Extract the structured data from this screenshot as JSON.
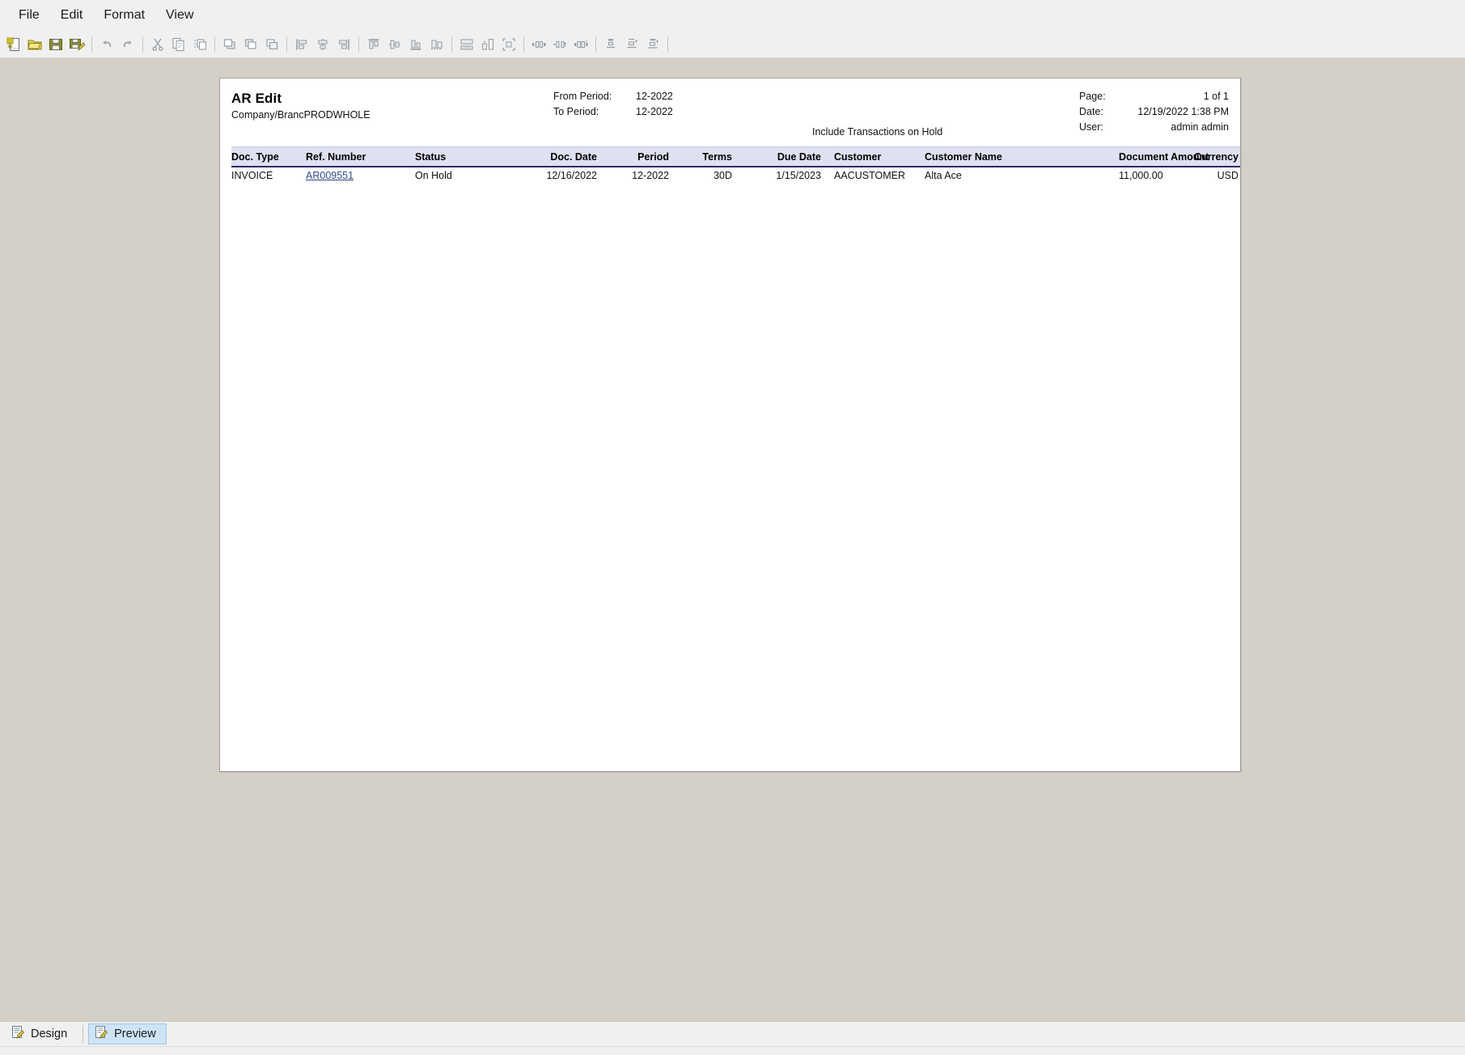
{
  "menubar": {
    "items": [
      {
        "label": "File"
      },
      {
        "label": "Edit"
      },
      {
        "label": "Format"
      },
      {
        "label": "View"
      }
    ]
  },
  "toolbar": {
    "groups": [
      {
        "buttons": [
          {
            "icon": "new-report-icon",
            "name": "new-report-button"
          },
          {
            "icon": "open-folder-icon",
            "name": "open-button"
          },
          {
            "icon": "save-icon",
            "name": "save-button"
          },
          {
            "icon": "save-as-icon",
            "name": "save-as-button"
          }
        ]
      },
      {
        "buttons": [
          {
            "icon": "undo-icon",
            "name": "undo-button"
          },
          {
            "icon": "redo-icon",
            "name": "redo-button"
          }
        ]
      },
      {
        "buttons": [
          {
            "icon": "cut-scissors-icon",
            "name": "cut-button"
          },
          {
            "icon": "copy-icon",
            "name": "copy-button"
          },
          {
            "icon": "paste-icon",
            "name": "paste-button"
          }
        ]
      },
      {
        "buttons": [
          {
            "icon": "bring-to-front-icon",
            "name": "bring-to-front-button"
          },
          {
            "icon": "send-to-back-icon",
            "name": "send-to-back-button"
          },
          {
            "icon": "group-icon",
            "name": "group-button"
          }
        ]
      },
      {
        "buttons": [
          {
            "icon": "align-left-icon",
            "name": "align-left-button"
          },
          {
            "icon": "align-center-icon",
            "name": "align-center-button"
          },
          {
            "icon": "align-right-icon",
            "name": "align-right-button"
          }
        ]
      },
      {
        "buttons": [
          {
            "icon": "align-top-icon",
            "name": "align-top-button"
          },
          {
            "icon": "align-middle-icon",
            "name": "align-middle-button"
          },
          {
            "icon": "align-bottom-icon",
            "name": "align-bottom-button"
          },
          {
            "icon": "align-baseline-icon",
            "name": "align-baseline-button"
          }
        ]
      },
      {
        "buttons": [
          {
            "icon": "same-width-icon",
            "name": "same-width-button"
          },
          {
            "icon": "same-height-icon",
            "name": "same-height-button"
          },
          {
            "icon": "same-size-icon",
            "name": "same-size-button"
          }
        ]
      },
      {
        "buttons": [
          {
            "icon": "space-horizontal-icon",
            "name": "space-horizontal-button"
          },
          {
            "icon": "increase-horizontal-space-icon",
            "name": "increase-horizontal-space-button"
          },
          {
            "icon": "decrease-horizontal-space-icon",
            "name": "decrease-horizontal-space-button"
          }
        ]
      },
      {
        "buttons": [
          {
            "icon": "space-vertical-icon",
            "name": "space-vertical-button"
          },
          {
            "icon": "increase-vertical-space-icon",
            "name": "increase-vertical-space-button"
          },
          {
            "icon": "decrease-vertical-space-icon",
            "name": "decrease-vertical-space-button"
          }
        ]
      }
    ]
  },
  "report": {
    "title": "AR Edit",
    "subtitle": "Company/BrancPRODWHOLE",
    "params": {
      "from_period_label": "From Period:",
      "from_period_value": "12-2022",
      "to_period_label": "To Period:",
      "to_period_value": "12-2022",
      "include_on_hold_note": "Include Transactions on Hold"
    },
    "meta": {
      "page_label": "Page:",
      "page_value": "1 of 1",
      "date_label": "Date:",
      "date_value": "12/19/2022 1:38 PM",
      "user_label": "User:",
      "user_value": "admin admin"
    },
    "table": {
      "columns": [
        "Doc. Type",
        "Ref. Number",
        "Status",
        "Doc. Date",
        "Period",
        "Terms",
        "Due Date",
        "Customer",
        "Customer Name",
        "Document Amount",
        "Currency"
      ],
      "rows": [
        {
          "doc_type": "INVOICE",
          "ref_number": "AR009551",
          "status": "On Hold",
          "doc_date": "12/16/2022",
          "period": "12-2022",
          "terms": "30D",
          "due_date": "1/15/2023",
          "customer": "AACUSTOMER",
          "customer_name": "Alta Ace",
          "document_amount": "11,000.00",
          "currency": "USD"
        }
      ]
    }
  },
  "tabstrip": {
    "tabs": [
      {
        "label": "Design",
        "active": false,
        "icon": "design-page-icon"
      },
      {
        "label": "Preview",
        "active": true,
        "icon": "preview-page-icon"
      }
    ]
  },
  "colors": {
    "table_header_bg": "#dfe0f2",
    "table_header_rule": "#2b2f63",
    "link": "#2b4a8b",
    "canvas_bg": "#d4d0c8",
    "chrome_bg": "#f0f0f0",
    "active_tab_bg": "#cde4f7"
  }
}
